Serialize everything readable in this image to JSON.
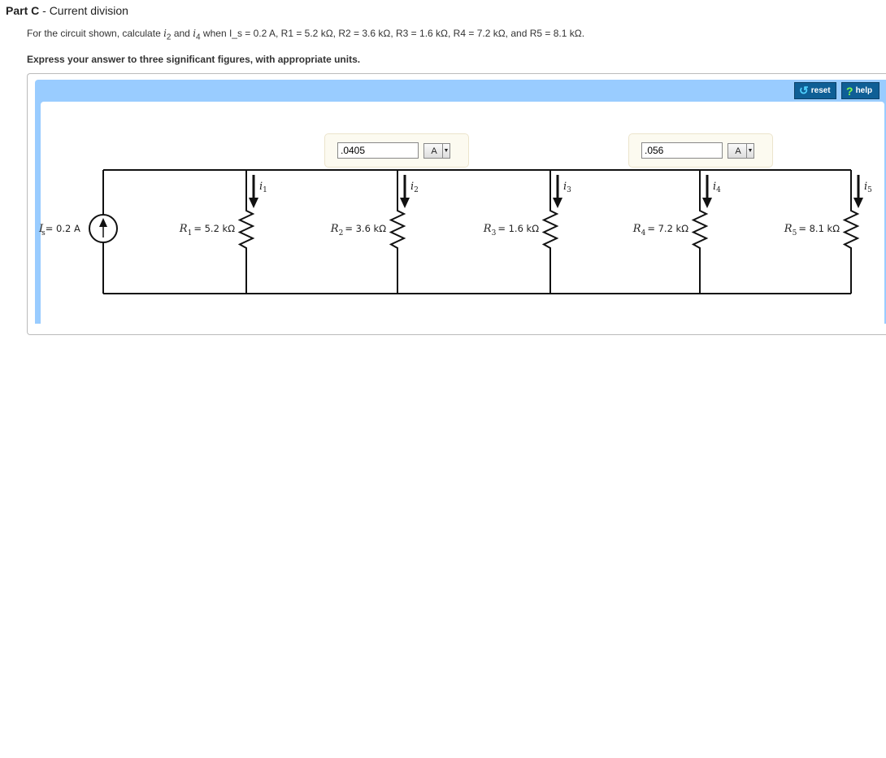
{
  "part": {
    "label": "Part C",
    "separator": " - ",
    "title": "Current division"
  },
  "question": {
    "prefix": "For the circuit shown, calculate ",
    "var1": "i",
    "var1_sub": "2",
    "and": " and ",
    "var2": "i",
    "var2_sub": "4",
    "when": " when ",
    "givens": "I_s = 0.2 A, R1 = 5.2 kΩ, R2 = 3.6 kΩ, R3 = 1.6 kΩ, R4 = 7.2 kΩ, and R5 = 8.1 kΩ."
  },
  "instruction": "Express your answer to three significant figures, with appropriate units.",
  "toolbar": {
    "reset_label": "reset",
    "help_label": "help",
    "reset_icon": "undo-arrow-icon",
    "help_icon": "question-mark-icon"
  },
  "answers": [
    {
      "value": ".0405",
      "unit": "A"
    },
    {
      "value": ".056",
      "unit": "A"
    }
  ],
  "circuit": {
    "source": {
      "name": "I",
      "sub": "s",
      "value": "= 0.2 A"
    },
    "resistors": [
      {
        "name": "R",
        "sub": "1",
        "value": "= 5.2 kΩ",
        "current": "i",
        "current_sub": "1"
      },
      {
        "name": "R",
        "sub": "2",
        "value": "= 3.6 kΩ",
        "current": "i",
        "current_sub": "2"
      },
      {
        "name": "R",
        "sub": "3",
        "value": "= 1.6 kΩ",
        "current": "i",
        "current_sub": "3"
      },
      {
        "name": "R",
        "sub": "4",
        "value": "= 7.2 kΩ",
        "current": "i",
        "current_sub": "4"
      },
      {
        "name": "R",
        "sub": "5",
        "value": "= 8.1 kΩ",
        "current": "i",
        "current_sub": "5"
      }
    ]
  },
  "colors": {
    "panel": "#99ccff",
    "button": "#0f5f96",
    "answer_box": "#fcfaf0"
  }
}
